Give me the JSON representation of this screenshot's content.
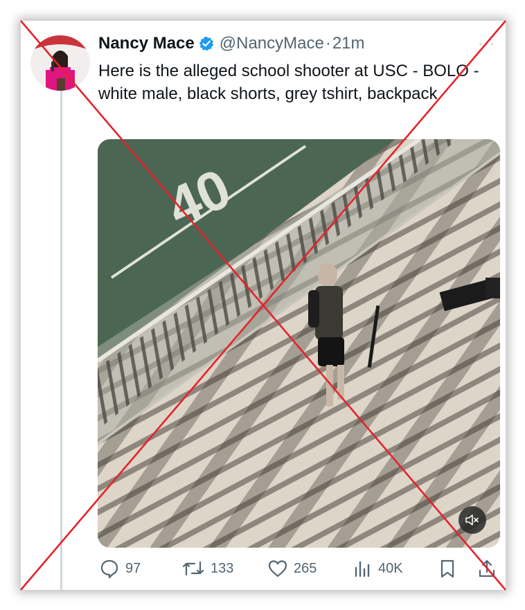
{
  "tweet": {
    "author_name": "Nancy Mace",
    "handle": "@NancyMace",
    "separator": "·",
    "time": "21m",
    "more_label": "···",
    "text": "Here is the alleged school shooter at USC - BOLO - white male, black shorts, grey tshirt, backpack"
  },
  "media": {
    "field_marking": "40",
    "muted_icon": "speaker-muted-icon"
  },
  "actions": {
    "replies": "97",
    "reposts": "133",
    "likes": "265",
    "views": "40K"
  },
  "icons": {
    "reply": "speech-bubble-icon",
    "repost": "repost-arrows-icon",
    "like": "heart-icon",
    "views": "bar-chart-icon",
    "bookmark": "bookmark-icon",
    "share": "share-icon",
    "verified": "verified-badge-icon"
  },
  "colors": {
    "verified_blue": "#1d9bf0",
    "text_primary": "#0f1419",
    "text_secondary": "#536471",
    "overlay_x": "#e3232b",
    "field_green": "#3d5a46",
    "bridge_deck": "#ddd5c7"
  }
}
